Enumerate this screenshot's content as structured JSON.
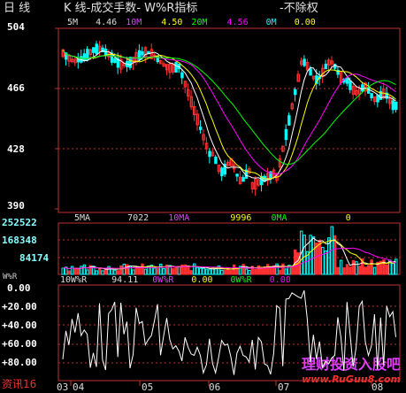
{
  "title": {
    "period": "日 线",
    "indicators": "K 线-成交手数- W%R指标",
    "rights": "-不除权"
  },
  "price_panel": {
    "legend": [
      {
        "label": "5M",
        "value": "4.46",
        "color": "#ffffff"
      },
      {
        "label": "10M",
        "value": "4.50",
        "color": "#ffff00"
      },
      {
        "label": "20M",
        "value": "4.56",
        "color": "#ff00ff"
      },
      {
        "label": "0M",
        "value": "0.00",
        "color": "#00ff00"
      }
    ],
    "y_labels": [
      "504",
      "466",
      "428",
      "390"
    ]
  },
  "volume_panel": {
    "legend": [
      {
        "label": "5MA",
        "value": "7022",
        "color": "#ffffff"
      },
      {
        "label": "10MA",
        "value": "9996",
        "color": "#ffff00"
      },
      {
        "label": "0MA",
        "value": "0",
        "color": "#ff00ff"
      }
    ],
    "y_labels": [
      "252522",
      "168348",
      "84174"
    ]
  },
  "wr_panel": {
    "unit_label": "W%R",
    "legend": [
      {
        "label": "10W%R",
        "value": "94.11",
        "color": "#ffffff"
      },
      {
        "label": "0W%R",
        "value": "0.00",
        "color": "#ffff00"
      },
      {
        "label": "0W%R",
        "value": "0.00",
        "color": "#ff00ff"
      }
    ],
    "y_labels": [
      "0.00",
      "+20.00",
      "+40.00",
      "+60.00",
      "+80.00"
    ]
  },
  "x_axis_labels": [
    "03",
    "04",
    "05",
    "06",
    "07",
    "08"
  ],
  "bottom_left": "资讯16",
  "watermark": {
    "line1": "理财投资入股吧",
    "line2": "www.RuGuu8.com"
  },
  "colors": {
    "up": "#ff3030",
    "down": "#00ffff",
    "grid": "#c03030",
    "axis": "#c03030"
  }
}
